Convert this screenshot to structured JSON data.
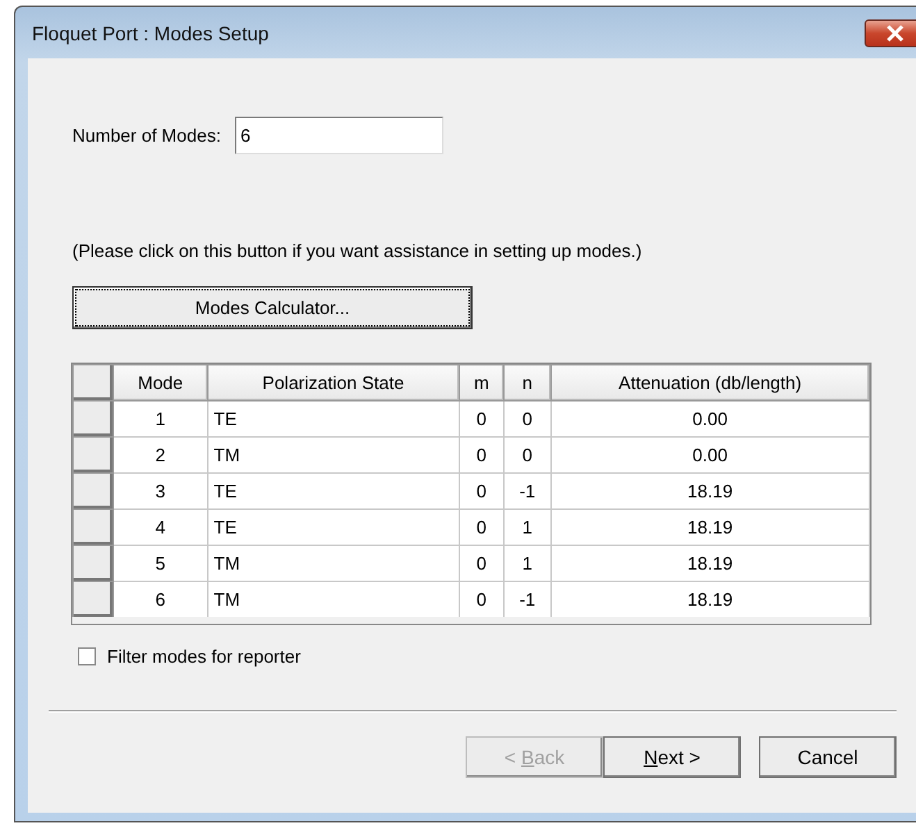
{
  "window": {
    "title": "Floquet Port : Modes Setup"
  },
  "modes_count": {
    "label": "Number of Modes:",
    "value": "6"
  },
  "hint": "(Please click on this button if you want assistance in setting up modes.)",
  "calculator_button": {
    "label": "Modes Calculator...",
    "focused": true
  },
  "table": {
    "columns": [
      "Mode",
      "Polarization State",
      "m",
      "n",
      "Attenuation (db/length)"
    ],
    "rows": [
      {
        "cells": [
          "1",
          "TE",
          "0",
          "0",
          "0.00"
        ]
      },
      {
        "cells": [
          "2",
          "TM",
          "0",
          "0",
          "0.00"
        ]
      },
      {
        "cells": [
          "3",
          "TE",
          "0",
          "-1",
          "18.19"
        ]
      },
      {
        "cells": [
          "4",
          "TE",
          "0",
          "1",
          "18.19"
        ]
      },
      {
        "cells": [
          "5",
          "TM",
          "0",
          "1",
          "18.19"
        ]
      },
      {
        "cells": [
          "6",
          "TM",
          "0",
          "-1",
          "18.19"
        ]
      }
    ]
  },
  "filter_checkbox": {
    "label": "Filter modes for reporter",
    "checked": false
  },
  "buttons": [
    {
      "before": "< ",
      "access_key": "B",
      "after": "ack",
      "disabled": true
    },
    {
      "access_key": "N",
      "after": "ext >",
      "disabled": false
    },
    {
      "before": "Cancel",
      "disabled": false
    }
  ]
}
